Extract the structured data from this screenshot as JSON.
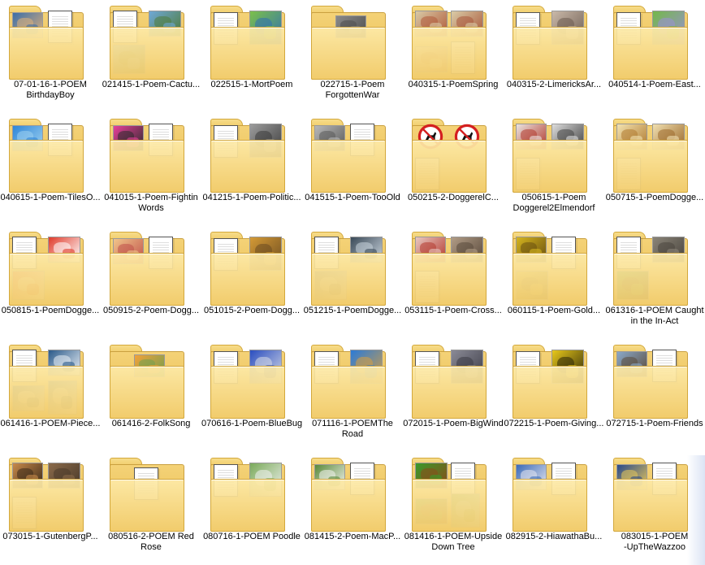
{
  "folders": [
    {
      "label": "07-01-16-1-POEM\nBirthdayBoy",
      "thumbs": [
        {
          "kind": "pic",
          "c": "#3c6ea8",
          "c2": "#e0b27a"
        },
        {
          "kind": "doc"
        }
      ]
    },
    {
      "label": "021415-1-Poem-Cactu...",
      "thumbs": [
        {
          "kind": "doc"
        },
        {
          "kind": "pic",
          "c": "#6fa8d6",
          "c2": "#4f7b3a"
        },
        {
          "kind": "pic",
          "c": "#7bb3d9",
          "c2": "#50743b"
        }
      ]
    },
    {
      "label": "022515-1-MortPoem",
      "thumbs": [
        {
          "kind": "doc"
        },
        {
          "kind": "pic",
          "c": "#7cc04a",
          "c2": "#2f6fb0"
        }
      ]
    },
    {
      "label": "022715-1-Poem\nForgottenWar",
      "thumbs": [
        {
          "kind": "pic",
          "c": "#8a8a8a",
          "c2": "#4e4e4e"
        }
      ]
    },
    {
      "label": "040315-1-PoemSpring",
      "thumbs": [
        {
          "kind": "pic",
          "c": "#d8c9a5",
          "c2": "#b05a3a"
        },
        {
          "kind": "pic",
          "c": "#d9cba6",
          "c2": "#a9583c"
        },
        {
          "kind": "pic",
          "c": "#e9d9b4",
          "c2": "#c0733e"
        },
        {
          "kind": "doc"
        }
      ]
    },
    {
      "label": "040315-2-LimericksAr...",
      "thumbs": [
        {
          "kind": "doc"
        },
        {
          "kind": "pic",
          "c": "#c9b8a8",
          "c2": "#6b5b51"
        }
      ]
    },
    {
      "label": "040514-1-Poem-East...",
      "thumbs": [
        {
          "kind": "doc"
        },
        {
          "kind": "pic",
          "c": "#74b84a",
          "c2": "#9a8fd6"
        }
      ]
    },
    {
      "label": "040615-1-Poem-TilesO...",
      "thumbs": [
        {
          "kind": "pic",
          "c": "#2f86d8",
          "c2": "#9fd2f0"
        },
        {
          "kind": "doc"
        }
      ]
    },
    {
      "label": "041015-1-Poem-Fightin\nWords",
      "thumbs": [
        {
          "kind": "pic",
          "c": "#e8409a",
          "c2": "#2a2a2a"
        },
        {
          "kind": "doc"
        }
      ]
    },
    {
      "label": "041215-1-Poem-Politic...",
      "thumbs": [
        {
          "kind": "doc"
        },
        {
          "kind": "pic",
          "c": "#9c9c9c",
          "c2": "#3a3a3a"
        }
      ]
    },
    {
      "label": "041515-1-Poem-TooOld",
      "thumbs": [
        {
          "kind": "pic",
          "c": "#b8b8b8",
          "c2": "#5a5a5a"
        },
        {
          "kind": "doc"
        }
      ]
    },
    {
      "label": "050215-2-DoggerelC...",
      "thumbs": [
        {
          "kind": "sign"
        },
        {
          "kind": "sign"
        },
        {
          "kind": "doc"
        }
      ]
    },
    {
      "label": "050615-1-Poem\nDoggerel2Elmendorf",
      "thumbs": [
        {
          "kind": "pic",
          "c": "#e9e3df",
          "c2": "#b23a2e"
        },
        {
          "kind": "pic",
          "c": "#dcdcdc",
          "c2": "#444444"
        },
        {
          "kind": "doc"
        }
      ]
    },
    {
      "label": "050715-1-PoemDogge...",
      "thumbs": [
        {
          "kind": "pic",
          "c": "#f2e2b0",
          "c2": "#b07a30"
        },
        {
          "kind": "pic",
          "c": "#f0dfb0",
          "c2": "#9c6a2c"
        },
        {
          "kind": "doc"
        }
      ]
    },
    {
      "label": "050815-1-PoemDogge...",
      "thumbs": [
        {
          "kind": "doc"
        },
        {
          "kind": "pic",
          "c": "#e03a2a",
          "c2": "#ffffff"
        },
        {
          "kind": "pic",
          "c": "#e23b2b",
          "c2": "#f1f1f1"
        }
      ]
    },
    {
      "label": "050915-2-Poem-Dogg...",
      "thumbs": [
        {
          "kind": "pic",
          "c": "#f0c48a",
          "c2": "#c0504a"
        },
        {
          "kind": "doc"
        }
      ]
    },
    {
      "label": "051015-2-Poem-Dogg...",
      "thumbs": [
        {
          "kind": "doc"
        },
        {
          "kind": "pic",
          "c": "#d49a36",
          "c2": "#6a4a20"
        }
      ]
    },
    {
      "label": "051215-1-PoemDogge...",
      "thumbs": [
        {
          "kind": "doc"
        },
        {
          "kind": "pic",
          "c": "#3a4a58",
          "c2": "#c9d3dc"
        },
        {
          "kind": "pic",
          "c": "#4a5a6a",
          "c2": "#d0d8e0"
        }
      ]
    },
    {
      "label": "053115-1-Poem-Cross...",
      "thumbs": [
        {
          "kind": "pic",
          "c": "#e7c7c0",
          "c2": "#b53a30"
        },
        {
          "kind": "pic",
          "c": "#b19c86",
          "c2": "#5a4a3c"
        },
        {
          "kind": "doc"
        }
      ]
    },
    {
      "label": "060115-1-Poem-Gold...",
      "thumbs": [
        {
          "kind": "pic",
          "c": "#d4b41e",
          "c2": "#6a5010"
        },
        {
          "kind": "doc"
        },
        {
          "kind": "pic",
          "c": "#d8b820",
          "c2": "#5e4a0e"
        }
      ]
    },
    {
      "label": "061316-1-POEM Caught\nin the In-Act",
      "thumbs": [
        {
          "kind": "doc"
        },
        {
          "kind": "pic",
          "c": "#8a8478",
          "c2": "#4a453e"
        },
        {
          "kind": "pic",
          "c": "#2f9a3a",
          "c2": "#1a1a1a"
        }
      ]
    },
    {
      "label": "061416-1-POEM-Piece...",
      "thumbs": [
        {
          "kind": "doc"
        },
        {
          "kind": "pic",
          "c": "#2a5a8a",
          "c2": "#e8eef4"
        },
        {
          "kind": "pic",
          "c": "#20507e",
          "c2": "#dfe8f0"
        },
        {
          "kind": "pic",
          "c": "#2b5c8c",
          "c2": "#e4ecf2"
        }
      ]
    },
    {
      "label": "061416-2-FolkSong",
      "thumbs": [
        {
          "kind": "pic",
          "c": "#f2a13a",
          "c2": "#6fa050"
        }
      ]
    },
    {
      "label": "070616-1-Poem-BlueBug",
      "thumbs": [
        {
          "kind": "doc"
        },
        {
          "kind": "pic",
          "c": "#2a4ec0",
          "c2": "#d8dce6"
        }
      ]
    },
    {
      "label": "071116-1-POEMThe\nRoad",
      "thumbs": [
        {
          "kind": "doc"
        },
        {
          "kind": "pic",
          "c": "#2a7ad8",
          "c2": "#d8a040"
        }
      ]
    },
    {
      "label": "072015-1-Poem-BigWind",
      "thumbs": [
        {
          "kind": "doc"
        },
        {
          "kind": "pic",
          "c": "#8a8a96",
          "c2": "#3a3a44"
        }
      ]
    },
    {
      "label": "072215-1-Poem-Giving...",
      "thumbs": [
        {
          "kind": "doc"
        },
        {
          "kind": "pic",
          "c": "#e8c81a",
          "c2": "#2a2408"
        }
      ]
    },
    {
      "label": "072715-1-Poem-Friends",
      "thumbs": [
        {
          "kind": "pic",
          "c": "#8aa8c8",
          "c2": "#5a4a3a"
        },
        {
          "kind": "doc"
        }
      ]
    },
    {
      "label": "073015-1-GutenbergP...",
      "thumbs": [
        {
          "kind": "pic",
          "c": "#c88a4a",
          "c2": "#3a2a1a"
        },
        {
          "kind": "pic",
          "c": "#8a6a4a",
          "c2": "#4a3a2a"
        },
        {
          "kind": "doc"
        }
      ]
    },
    {
      "label": "080516-2-POEM Red\nRose",
      "thumbs": [
        {
          "kind": "doc"
        }
      ]
    },
    {
      "label": "080716-1-POEM Poodle",
      "thumbs": [
        {
          "kind": "doc"
        },
        {
          "kind": "pic",
          "c": "#7aaa5a",
          "c2": "#f2f2f2"
        }
      ]
    },
    {
      "label": "081415-2-Poem-MacP...",
      "thumbs": [
        {
          "kind": "pic",
          "c": "#5a8a3a",
          "c2": "#f4f4f0"
        },
        {
          "kind": "doc"
        }
      ]
    },
    {
      "label": "081416-1-POEM-Upside\nDown Tree",
      "thumbs": [
        {
          "kind": "pic",
          "c": "#3a9a2a",
          "c2": "#8a4a1a"
        },
        {
          "kind": "doc"
        },
        {
          "kind": "pic",
          "c": "#3a9a2a",
          "c2": "#8a4a1a"
        },
        {
          "kind": "pic",
          "c": "#4a8a3a",
          "c2": "#9ad0e8"
        }
      ]
    },
    {
      "label": "082915-2-HiawathaBu...",
      "thumbs": [
        {
          "kind": "pic",
          "c": "#3a6ab8",
          "c2": "#e8e8f0"
        },
        {
          "kind": "doc"
        }
      ]
    },
    {
      "label": "083015-1-POEM\n-UpTheWazzoo",
      "thumbs": [
        {
          "kind": "pic",
          "c": "#2a4a8a",
          "c2": "#e8c85a"
        },
        {
          "kind": "doc"
        }
      ]
    }
  ],
  "colors": {
    "folder_back": "#e8bb4c",
    "folder_front": "#f8dd8c",
    "folder_edge": "#d3a83c",
    "selection_hint": "#becdeb"
  }
}
